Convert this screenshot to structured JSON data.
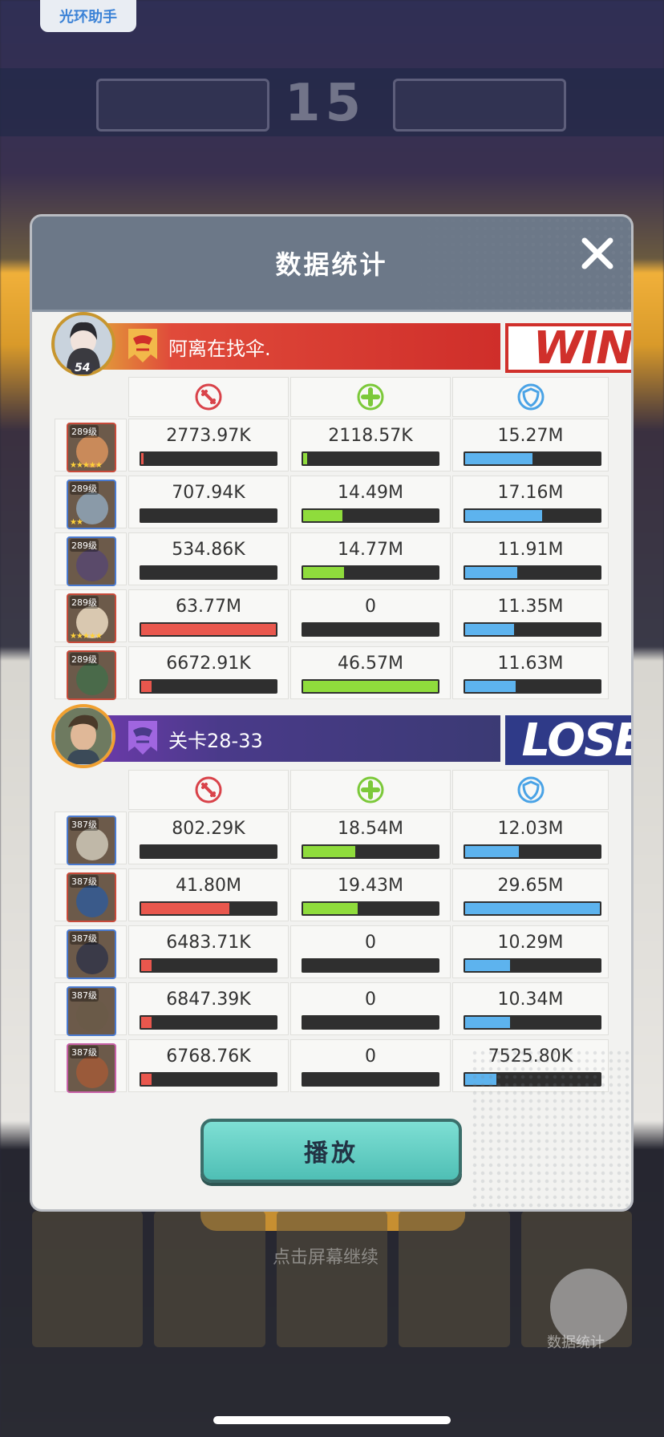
{
  "assistant_tag": "光环助手",
  "background": {
    "score": "15",
    "hint": "点击屏幕继续",
    "stats_button_label": "数据统计"
  },
  "dialog": {
    "title": "数据统计",
    "play_label": "播放"
  },
  "team_win": {
    "player_name": "阿离在找伞.",
    "player_level": "54",
    "result": "WIN",
    "heroes": [
      {
        "level": "289级",
        "stars": "★★★★★",
        "damage": "2773.97K",
        "damage_pct": 4,
        "heal": "2118.57K",
        "heal_pct": 5,
        "tank": "15.27M",
        "tank_pct": 51
      },
      {
        "level": "289级",
        "stars": "★★",
        "damage": "707.94K",
        "damage_pct": 1,
        "heal": "14.49M",
        "heal_pct": 31,
        "tank": "17.16M",
        "tank_pct": 58
      },
      {
        "level": "289级",
        "stars": "",
        "damage": "534.86K",
        "damage_pct": 1,
        "heal": "14.77M",
        "heal_pct": 32,
        "tank": "11.91M",
        "tank_pct": 40
      },
      {
        "level": "289级",
        "stars": "★★★★★",
        "damage": "63.77M",
        "damage_pct": 100,
        "heal": "0",
        "heal_pct": 0,
        "tank": "11.35M",
        "tank_pct": 38
      },
      {
        "level": "289级",
        "stars": "",
        "damage": "6672.91K",
        "damage_pct": 10,
        "heal": "46.57M",
        "heal_pct": 100,
        "tank": "11.63M",
        "tank_pct": 39
      }
    ]
  },
  "team_lose": {
    "stage_name": "关卡28-33",
    "result": "LOSE",
    "heroes": [
      {
        "level": "387级",
        "damage": "802.29K",
        "damage_pct": 1,
        "heal": "18.54M",
        "heal_pct": 40,
        "tank": "12.03M",
        "tank_pct": 41
      },
      {
        "level": "387级",
        "damage": "41.80M",
        "damage_pct": 66,
        "heal": "19.43M",
        "heal_pct": 42,
        "tank": "29.65M",
        "tank_pct": 100
      },
      {
        "level": "387级",
        "damage": "6483.71K",
        "damage_pct": 10,
        "heal": "0",
        "heal_pct": 0,
        "tank": "10.29M",
        "tank_pct": 35
      },
      {
        "level": "387级",
        "damage": "6847.39K",
        "damage_pct": 10,
        "heal": "0",
        "heal_pct": 0,
        "tank": "10.34M",
        "tank_pct": 35
      },
      {
        "level": "387级",
        "damage": "6768.76K",
        "damage_pct": 10,
        "heal": "0",
        "heal_pct": 0,
        "tank": "7525.80K",
        "tank_pct": 25
      }
    ]
  },
  "icons": {
    "damage": "sword-icon",
    "heal": "cross-icon",
    "tank": "shield-icon",
    "close": "close-icon"
  },
  "colors": {
    "damage": "#e9574d",
    "heal": "#8fdc3c",
    "tank": "#5db3ee",
    "win": "#d0302b",
    "lose": "#2f3a88"
  }
}
